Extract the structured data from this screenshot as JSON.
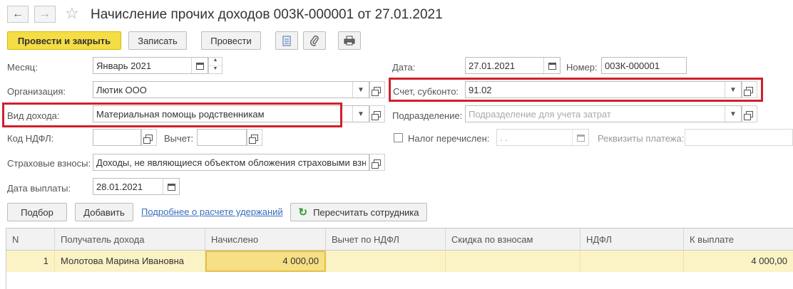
{
  "window": {
    "title": "Начисление прочих доходов 003К-000001 от 27.01.2021",
    "back_icon": "arrow-left-icon",
    "forward_icon": "arrow-right-icon",
    "favorite_icon": "star-icon"
  },
  "toolbar": {
    "post_and_close": "Провести и закрыть",
    "save": "Записать",
    "post": "Провести",
    "icons": [
      "document-icon",
      "paperclip-icon",
      "printer-icon"
    ]
  },
  "form": {
    "month": {
      "label": "Месяц:",
      "value": "Январь 2021"
    },
    "date": {
      "label": "Дата:",
      "value": "27.01.2021"
    },
    "number": {
      "label": "Номер:",
      "value": "003К-000001"
    },
    "organization": {
      "label": "Организация:",
      "value": "Лютик ООО"
    },
    "account": {
      "label": "Счет, субконто:",
      "value": "91.02"
    },
    "income_type": {
      "label": "Вид дохода:",
      "value": "Материальная помощь родственникам"
    },
    "department": {
      "label": "Подразделение:",
      "placeholder": "Подразделение для учета затрат"
    },
    "ndfl_code": {
      "label": "Код НДФЛ:",
      "value": ""
    },
    "deduction": {
      "label": "Вычет:",
      "value": ""
    },
    "tax_transferred": {
      "label": "Налог перечислен:",
      "value": " .  . ",
      "checked": false
    },
    "payment_details": {
      "label": "Реквизиты платежа:"
    },
    "insurance": {
      "label": "Страховые взносы:",
      "value": "Доходы, не являющиеся объектом обложения страховыми взносами"
    },
    "payment_date": {
      "label": "Дата выплаты:",
      "value": "28.01.2021"
    }
  },
  "actions": {
    "select": "Подбор",
    "add": "Добавить",
    "details_link": "Подробнее о расчете удержаний",
    "recalc": "Пересчитать сотрудника"
  },
  "table": {
    "columns": [
      "N",
      "Получатель дохода",
      "Начислено",
      "Вычет по НДФЛ",
      "Скидка по взносам",
      "НДФЛ",
      "К выплате"
    ],
    "rows": [
      {
        "n": "1",
        "recipient": "Молотова Марина Ивановна",
        "accrued": "4 000,00",
        "ndfl_deduction": "",
        "discount": "",
        "ndfl": "",
        "to_pay": "4 000,00"
      }
    ]
  }
}
